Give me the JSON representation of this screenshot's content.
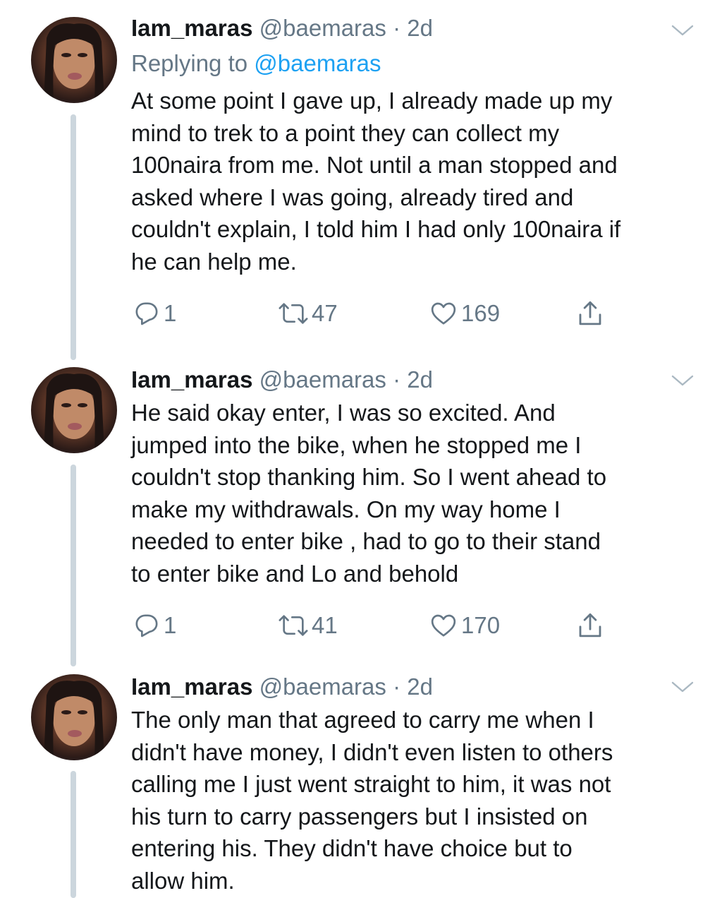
{
  "tweets": [
    {
      "name": "Iam_maras",
      "handle": "@baemaras",
      "separator": "·",
      "time": "2d",
      "replying_prefix": "Replying to ",
      "replying_to": "@baemaras",
      "text": "At some point I gave up, I already made up my\nmind to trek to a point they can collect my\n100naira from me. Not until a man stopped and\nasked where I was going, already tired and\ncouldn't explain, I told him I had only 100naira if\nhe can help me.",
      "replies": "1",
      "retweets": "47",
      "likes": "169"
    },
    {
      "name": "Iam_maras",
      "handle": "@baemaras",
      "separator": "·",
      "time": "2d",
      "text": "He said okay enter, I was so excited. And\njumped into the bike, when he stopped me I\ncouldn't stop thanking him. So I went ahead to\nmake my withdrawals. On my way home I\nneeded to enter bike , had to go to their stand\nto enter bike and Lo and behold",
      "replies": "1",
      "retweets": "41",
      "likes": "170"
    },
    {
      "name": "Iam_maras",
      "handle": "@baemaras",
      "separator": "·",
      "time": "2d",
      "text": "The only man that agreed to carry me when I\ndidn't have money, I didn't even listen to others\ncalling me I just went straight to him, it was not\nhis turn to carry passengers but I insisted on\nentering his. They didn't have choice but to\nallow him."
    }
  ],
  "icons": {
    "reply": "reply-icon",
    "retweet": "retweet-icon",
    "like": "heart-icon",
    "share": "share-icon",
    "menu": "chevron-down-icon"
  },
  "colors": {
    "text": "#14171a",
    "secondary": "#657786",
    "link": "#1da1f2",
    "thread_line": "#ccd6dd"
  }
}
